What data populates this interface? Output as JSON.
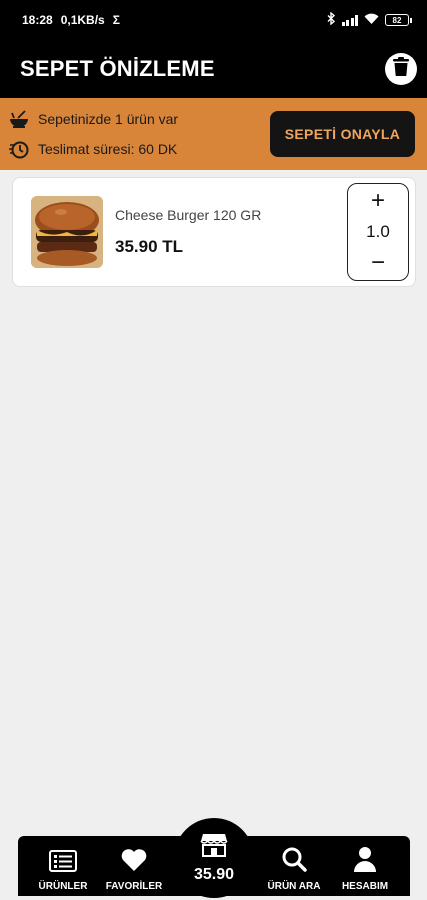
{
  "status_bar": {
    "time": "18:28",
    "network_speed": "0,1KB/s",
    "sigma": "Σ",
    "battery": "82"
  },
  "header": {
    "title": "SEPET ÖNİZLEME",
    "trash_icon": "trash-icon"
  },
  "info_bar": {
    "cart_count_text": "Sepetinizde 1 ürün var",
    "delivery_text": "Teslimat süresi: 60 DK",
    "confirm_label": "SEPETİ ONAYLA"
  },
  "cart_items": [
    {
      "name": "Cheese Burger 120 GR",
      "price": "35.90 TL",
      "quantity": "1.0",
      "plus": "+",
      "minus": "−"
    }
  ],
  "bottom_nav": {
    "items": [
      {
        "label": "ÜRÜNLER",
        "icon": "list-icon"
      },
      {
        "label": "FAVORİLER",
        "icon": "heart-icon"
      },
      {
        "label": "ÜRÜN ARA",
        "icon": "search-icon"
      },
      {
        "label": "HESABIM",
        "icon": "user-icon"
      }
    ],
    "cart_total": "35.90"
  },
  "colors": {
    "accent": "#d8853a",
    "button_text": "#f0a55c",
    "header_bg": "#000000",
    "background": "#efefef"
  }
}
